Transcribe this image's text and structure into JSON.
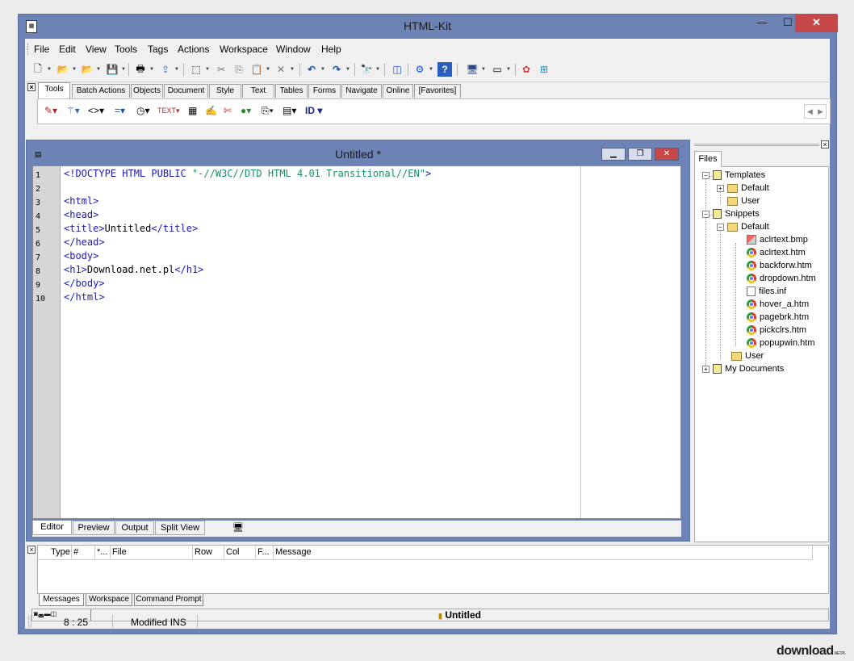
{
  "window": {
    "title": "HTML-Kit",
    "minimize": "—",
    "maximize": "☐",
    "close": "✕"
  },
  "menubar": [
    "File",
    "Edit",
    "View",
    "Tools",
    "Tags",
    "Actions",
    "Workspace",
    "Window",
    "Help"
  ],
  "tool_tabs": [
    "Tools",
    "Batch Actions",
    "Objects",
    "Document",
    "Style",
    "Text",
    "Tables",
    "Forms",
    "Navigate",
    "Online",
    "[Favorites]"
  ],
  "tool_row": {
    "id_label": "ID"
  },
  "document": {
    "title": "Untitled *",
    "line_numbers": [
      "1",
      "2",
      "3",
      "4",
      "5",
      "6",
      "7",
      "8",
      "9",
      "10"
    ],
    "code": {
      "l1_tag": "<!DOCTYPE HTML PUBLIC ",
      "l1_str": "\"-//W3C//DTD HTML 4.01 Transitional//EN\"",
      "l1_end": ">",
      "l3": "<html>",
      "l4": "<head>",
      "l5_open": "<title>",
      "l5_text": "Untitled",
      "l5_close": "</title>",
      "l6": "</head>",
      "l7": "<body>",
      "l8_open": "<h1>",
      "l8_text": "Download.net.pl",
      "l8_close": "</h1>",
      "l9": "</body>",
      "l10": "</html>"
    },
    "tabs": [
      "Editor",
      "Preview",
      "Output",
      "Split View"
    ],
    "active_tab": "Editor"
  },
  "files_panel": {
    "tab": "Files",
    "tree": {
      "templates": "Templates",
      "templates_default": "Default",
      "templates_user": "User",
      "snippets": "Snippets",
      "snippets_default": "Default",
      "files": [
        "aclrtext.bmp",
        "aclrtext.htm",
        "backforw.htm",
        "dropdown.htm",
        "files.inf",
        "hover_a.htm",
        "pagebrk.htm",
        "pickclrs.htm",
        "popupwin.htm"
      ],
      "snippets_user": "User",
      "my_documents": "My Documents"
    }
  },
  "messages": {
    "columns": [
      "Type",
      "#",
      "*...",
      "File",
      "Row",
      "Col",
      "F...",
      "Message"
    ],
    "tabs": [
      "Messages",
      "Workspace",
      "Command Prompt"
    ]
  },
  "docs_bar": {
    "active_doc": "Untitled"
  },
  "status": {
    "position": "8 : 25",
    "mode": "Modified INS"
  },
  "watermark": {
    "text": "download",
    "suffix": ".NET.PL"
  }
}
